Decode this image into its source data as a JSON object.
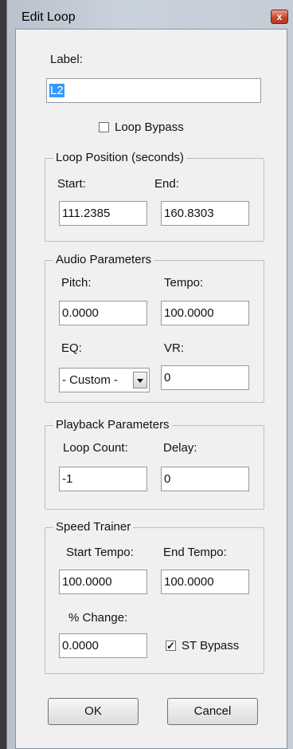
{
  "window": {
    "title": "Edit Loop",
    "close_glyph": "x"
  },
  "label_section": {
    "label": "Label:",
    "value": "L2",
    "bypass_label": "Loop Bypass",
    "bypass_checked": false
  },
  "loop_position": {
    "legend": "Loop Position (seconds)",
    "start_label": "Start:",
    "start_value": "111.2385",
    "end_label": "End:",
    "end_value": "160.8303"
  },
  "audio": {
    "legend": "Audio Parameters",
    "pitch_label": "Pitch:",
    "pitch_value": "0.0000",
    "tempo_label": "Tempo:",
    "tempo_value": "100.0000",
    "eq_label": "EQ:",
    "eq_value": "- Custom -",
    "vr_label": "VR:",
    "vr_value": "0"
  },
  "playback": {
    "legend": "Playback Parameters",
    "loop_count_label": "Loop Count:",
    "loop_count_value": "-1",
    "delay_label": "Delay:",
    "delay_value": "0"
  },
  "speed_trainer": {
    "legend": "Speed Trainer",
    "start_tempo_label": "Start Tempo:",
    "start_tempo_value": "100.0000",
    "end_tempo_label": "End Tempo:",
    "end_tempo_value": "100.0000",
    "change_label": "% Change:",
    "change_value": "0.0000",
    "st_bypass_label": "ST Bypass",
    "st_bypass_checked": true
  },
  "buttons": {
    "ok": "OK",
    "cancel": "Cancel"
  },
  "icons": {
    "checkbox_checked": "checkmark-icon",
    "dropdown": "chevron-down-icon",
    "close": "close-icon"
  }
}
